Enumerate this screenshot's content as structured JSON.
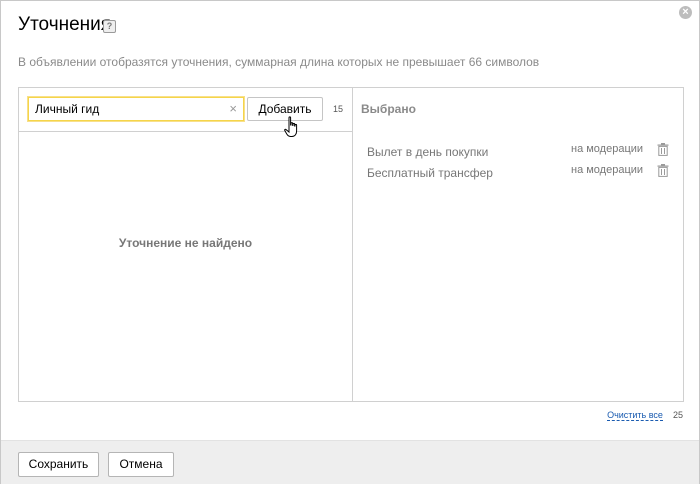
{
  "dialog": {
    "title": "Уточнения",
    "help_label": "?",
    "close_label": "×",
    "description": "В объявлении отобразятся уточнения, суммарная длина которых не превышает 66 символов"
  },
  "search": {
    "value": "Личный гид",
    "clear_label": "×",
    "add_label": "Добавить",
    "remaining": "15"
  },
  "results": {
    "empty_text": "Уточнение не найдено"
  },
  "chosen": {
    "title": "Выбрано",
    "items": [
      {
        "text": "Вылет в день покупки",
        "status": "на модерации",
        "icon": "trash-icon"
      },
      {
        "text": "Бесплатный трансфер",
        "status": "на модерации",
        "icon": "trash-icon"
      }
    ]
  },
  "footer_links": {
    "clear_all": "Очистить все",
    "total": "25"
  },
  "buttons": {
    "save": "Сохранить",
    "cancel": "Отмена"
  },
  "colors": {
    "focus_border": "#f5d54a",
    "link": "#1a5bb0",
    "footer_bg": "#eeeeee"
  }
}
